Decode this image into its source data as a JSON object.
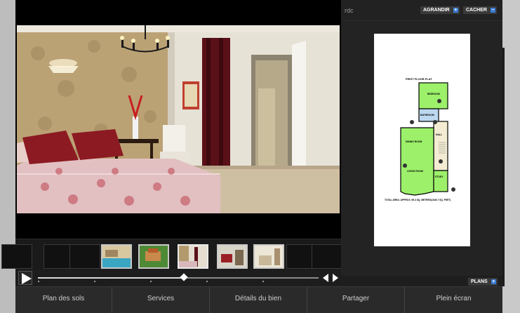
{
  "plan_panel": {
    "level_label": "rdc",
    "enlarge_label": "AGRANDIR",
    "enlarge_icon": "plus-icon",
    "hide_label": "CACHER",
    "hide_icon": "minus-icon",
    "plans_label": "PLANS",
    "plans_icon": "plus-icon",
    "floor_plan": {
      "title": "FIRST FLOOR FLAT",
      "rooms": [
        "BEDROOM",
        "BATHROOM",
        "HALL",
        "DINING ROOM",
        "LIVING ROOM",
        "STUDY"
      ],
      "area_note": "TOTAL AREA: APPROX. 95.4 SQ. METRES(1026.7 SQ. FEET)"
    }
  },
  "gallery": {
    "thumbnails": [
      {
        "kind": "empty"
      },
      {
        "kind": "empty"
      },
      {
        "kind": "empty"
      },
      {
        "kind": "photo",
        "scene": "pool"
      },
      {
        "kind": "photo",
        "scene": "garden"
      },
      {
        "kind": "photo",
        "scene": "bedroom",
        "selected": true
      },
      {
        "kind": "photo",
        "scene": "living-room"
      },
      {
        "kind": "photo",
        "scene": "room-light"
      },
      {
        "kind": "empty"
      },
      {
        "kind": "empty"
      }
    ],
    "progress_fraction": 0.52
  },
  "menu": {
    "items": [
      "Plan des sols",
      "Services",
      "Détails du bien",
      "Partager",
      "Plein écran"
    ]
  },
  "colors": {
    "accent_blue": "#3a7cd6",
    "plan_green": "#9cf06a",
    "plan_blue": "#bcd8f0"
  }
}
